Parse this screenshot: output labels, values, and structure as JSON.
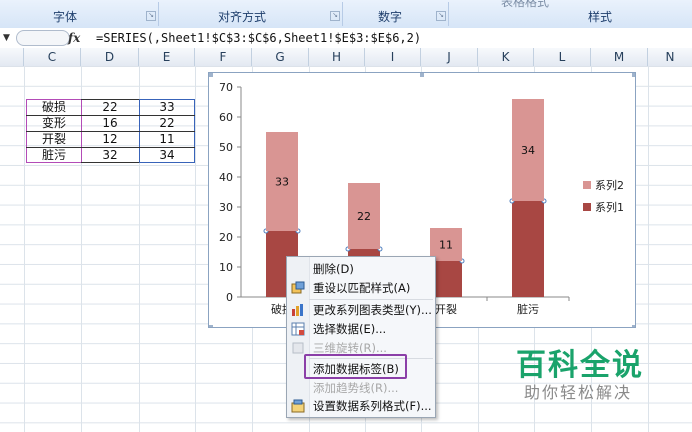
{
  "ribbon": {
    "groups": [
      "字体",
      "对齐方式",
      "数字",
      "样式"
    ],
    "cut_label": "表格格式"
  },
  "formula_bar": {
    "fx": "fx",
    "formula": "=SERIES(,Sheet1!$C$3:$C$6,Sheet1!$E$3:$E$6,2)"
  },
  "columns": [
    "C",
    "D",
    "E",
    "F",
    "G",
    "H",
    "I",
    "J",
    "K",
    "L",
    "M",
    "N"
  ],
  "table": [
    {
      "label": "破损",
      "d": "22",
      "e": "33"
    },
    {
      "label": "变形",
      "d": "16",
      "e": "22"
    },
    {
      "label": "开裂",
      "d": "12",
      "e": "11"
    },
    {
      "label": "脏污",
      "d": "32",
      "e": "34"
    }
  ],
  "chart_data": {
    "type": "bar",
    "stacked": true,
    "categories": [
      "破损",
      "变形",
      "开裂",
      "脏污"
    ],
    "series": [
      {
        "name": "系列1",
        "values": [
          22,
          16,
          12,
          32
        ],
        "color": "#a84743"
      },
      {
        "name": "系列2",
        "values": [
          33,
          22,
          11,
          34
        ],
        "color": "#d99593"
      }
    ],
    "data_labels_series2": [
      "33",
      "22",
      "11",
      "34"
    ],
    "ylim": [
      0,
      70
    ],
    "yticks": [
      "0",
      "10",
      "20",
      "30",
      "40",
      "50",
      "60",
      "70"
    ],
    "legend_position": "right",
    "grid": false
  },
  "context_menu": {
    "items": [
      {
        "label": "删除(D)",
        "icon": "none",
        "disabled": false
      },
      {
        "label": "重设以匹配样式(A)",
        "icon": "reset-style-icon",
        "disabled": false
      },
      {
        "label": "更改系列图表类型(Y)...",
        "icon": "chart-type-icon",
        "disabled": false
      },
      {
        "label": "选择数据(E)...",
        "icon": "select-data-icon",
        "disabled": false
      },
      {
        "label": "三维旋转(R)...",
        "icon": "rotate-3d-icon",
        "disabled": true
      },
      {
        "label": "添加数据标签(B)",
        "icon": "none",
        "disabled": false
      },
      {
        "label": "添加趋势线(R)...",
        "icon": "none",
        "disabled": true
      },
      {
        "label": "设置数据系列格式(F)...",
        "icon": "format-series-icon",
        "disabled": false
      }
    ]
  },
  "watermark": {
    "title": "百科全说",
    "subtitle": "助你轻松解决"
  }
}
